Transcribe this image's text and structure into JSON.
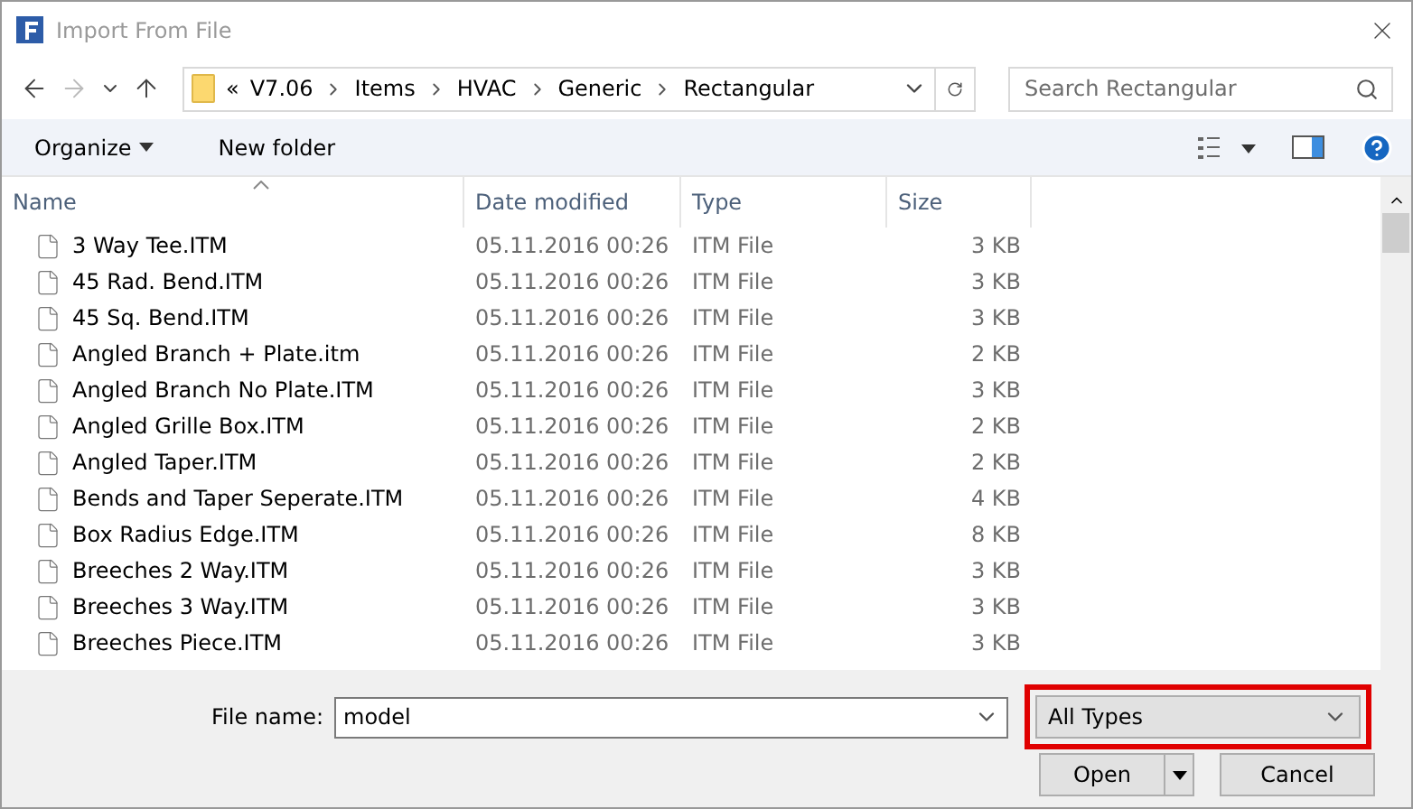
{
  "window": {
    "title": "Import From File"
  },
  "breadcrumb": {
    "overflow": "«",
    "segments": [
      "V7.06",
      "Items",
      "HVAC",
      "Generic",
      "Rectangular"
    ]
  },
  "search": {
    "placeholder": "Search Rectangular"
  },
  "toolbar": {
    "organize": "Organize",
    "new_folder": "New folder"
  },
  "table": {
    "columns": [
      "Name",
      "Date modified",
      "Type",
      "Size"
    ],
    "rows": [
      {
        "name": "3 Way Tee.ITM",
        "date": "05.11.2016 00:26",
        "type": "ITM File",
        "size": "3 KB"
      },
      {
        "name": "45 Rad. Bend.ITM",
        "date": "05.11.2016 00:26",
        "type": "ITM File",
        "size": "3 KB"
      },
      {
        "name": "45 Sq. Bend.ITM",
        "date": "05.11.2016 00:26",
        "type": "ITM File",
        "size": "3 KB"
      },
      {
        "name": "Angled Branch + Plate.itm",
        "date": "05.11.2016 00:26",
        "type": "ITM File",
        "size": "2 KB"
      },
      {
        "name": "Angled Branch No Plate.ITM",
        "date": "05.11.2016 00:26",
        "type": "ITM File",
        "size": "3 KB"
      },
      {
        "name": "Angled Grille Box.ITM",
        "date": "05.11.2016 00:26",
        "type": "ITM File",
        "size": "2 KB"
      },
      {
        "name": "Angled Taper.ITM",
        "date": "05.11.2016 00:26",
        "type": "ITM File",
        "size": "2 KB"
      },
      {
        "name": "Bends and Taper Seperate.ITM",
        "date": "05.11.2016 00:26",
        "type": "ITM File",
        "size": "4 KB"
      },
      {
        "name": "Box Radius Edge.ITM",
        "date": "05.11.2016 00:26",
        "type": "ITM File",
        "size": "8 KB"
      },
      {
        "name": "Breeches 2 Way.ITM",
        "date": "05.11.2016 00:26",
        "type": "ITM File",
        "size": "3 KB"
      },
      {
        "name": "Breeches 3 Way.ITM",
        "date": "05.11.2016 00:26",
        "type": "ITM File",
        "size": "3 KB"
      },
      {
        "name": "Breeches Piece.ITM",
        "date": "05.11.2016 00:26",
        "type": "ITM File",
        "size": "3 KB"
      }
    ]
  },
  "file_name": {
    "label": "File name:",
    "value": "model"
  },
  "file_type": {
    "value": "All Types",
    "highlighted": true
  },
  "buttons": {
    "open": "Open",
    "cancel": "Cancel"
  }
}
